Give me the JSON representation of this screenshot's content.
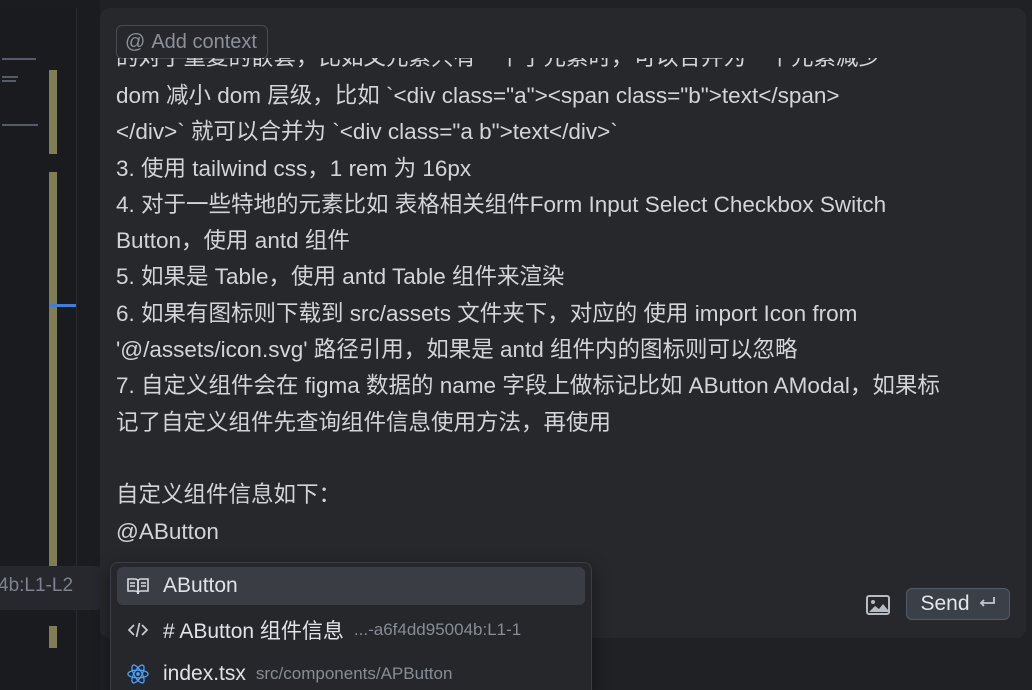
{
  "composer": {
    "add_context_label": "Add context",
    "partial_top_line": "的对于重复的嵌套，比如父元素只有一个子元素时，可以合并为一个元素减少",
    "lines": [
      "dom 减小 dom 层级，比如 `<div class=\"a\"><span class=\"b\">text</span>",
      "</div>` 就可以合并为 `<div class=\"a b\">text</div>`",
      "3. 使用 tailwind css，1 rem 为 16px",
      "4. 对于一些特地的元素比如 表格相关组件Form Input Select Checkbox Switch",
      "Button，使用 antd 组件",
      "5. 如果是 Table，使用 antd Table 组件来渲染",
      "6. 如果有图标则下载到 src/assets 文件夹下，对应的 使用 import Icon from",
      "'@/assets/icon.svg' 路径引用，如果是 antd 组件内的图标则可以忽略",
      "7. 自定义组件会在 figma 数据的 name 字段上做标记比如 AButton AModal，如果标",
      "记了自定义组件先查询组件信息使用方法，再使用",
      "",
      "自定义组件信息如下：",
      "@AButton"
    ],
    "send_label": "Send",
    "image_icon": "image-icon",
    "enter_icon": "enter-icon"
  },
  "left_panel": {
    "reference_text": "4b:L1-L2"
  },
  "suggestions": [
    {
      "icon": "book-icon",
      "label": "AButton",
      "detail": ""
    },
    {
      "icon": "code-icon",
      "label": "# AButton 组件信息",
      "detail": "...-a6f4dd95004b:L1-1"
    },
    {
      "icon": "react-icon",
      "label": "index.tsx",
      "detail": "src/components/APButton"
    }
  ],
  "colors": {
    "panel_bg": "#26282c",
    "accent_blue": "#3f7fdc",
    "react_icon": "#4aa3ff"
  }
}
